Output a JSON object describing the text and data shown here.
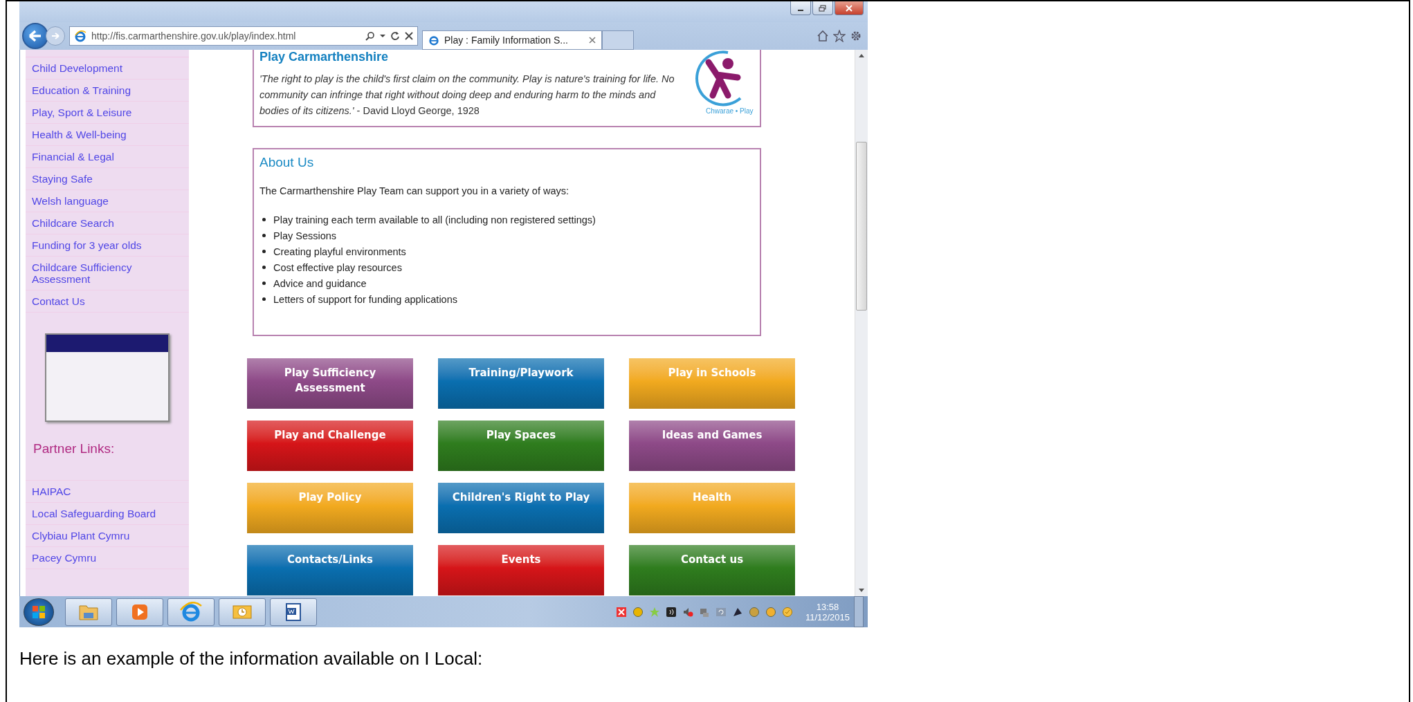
{
  "browser": {
    "address": "http://fis.carmarthenshire.gov.uk/play/index.html",
    "tabs": [
      {
        "title": "Play : Family Information S...",
        "selected": true
      }
    ]
  },
  "sidebar": {
    "items": [
      "Child Development",
      "Education & Training",
      "Play, Sport & Leisure",
      "Health & Well-being",
      "Financial & Legal",
      "Staying Safe",
      "Welsh language",
      "Childcare Search",
      "Funding for 3 year olds",
      "Childcare Sufficiency Assessment",
      "Contact Us"
    ],
    "partner_heading": "Partner Links:",
    "partner_links": [
      "HAIPAC",
      "Local Safeguarding Board",
      "Clybiau Plant Cymru",
      "Pacey Cymru"
    ]
  },
  "intro": {
    "title": "Play Carmarthenshire",
    "quote": "*'The right to play is the child's first claim on the community. Play is nature's training for life. No community can infringe that right without doing deep and enduring harm to the minds and bodies of its citizens.'* - David Lloyd George, 1928",
    "logo_text": "Chwarae • Play"
  },
  "about": {
    "title": "About Us",
    "intro": "The Carmarthenshire Play Team can support you in a variety of ways:",
    "bullets": [
      "Play training each term available to all (including non registered settings)",
      "Play Sessions",
      "Creating playful environments",
      "Cost effective play resources",
      "Advice and guidance",
      "Letters of support for funding applications"
    ]
  },
  "tiles": [
    {
      "label": "Play Sufficiency Assessment",
      "color": "#8e4a88"
    },
    {
      "label": "Training/Playwork",
      "color": "#0a6fb0"
    },
    {
      "label": "Play in Schools",
      "color": "#f2aa1f"
    },
    {
      "label": "Play and Challenge",
      "color": "#d61519"
    },
    {
      "label": "Play Spaces",
      "color": "#2f7d1e"
    },
    {
      "label": "Ideas and Games",
      "color": "#8e4a88"
    },
    {
      "label": "Play Policy",
      "color": "#f2aa1f"
    },
    {
      "label": "Children's Right to Play",
      "color": "#0a6fb0"
    },
    {
      "label": "Health",
      "color": "#f2aa1f"
    },
    {
      "label": "Contacts/Links",
      "color": "#0a6fb0"
    },
    {
      "label": "Events",
      "color": "#d61519"
    },
    {
      "label": "Contact us",
      "color": "#2f7d1e"
    }
  ],
  "taskbar": {
    "apps": [
      {
        "kind": "explorer"
      },
      {
        "kind": "media"
      },
      {
        "kind": "ie"
      },
      {
        "kind": "outlook"
      },
      {
        "kind": "word"
      }
    ],
    "time": "13:58",
    "date": "11/12/2015"
  },
  "caption": "Here is an example of the information available on I Local:"
}
